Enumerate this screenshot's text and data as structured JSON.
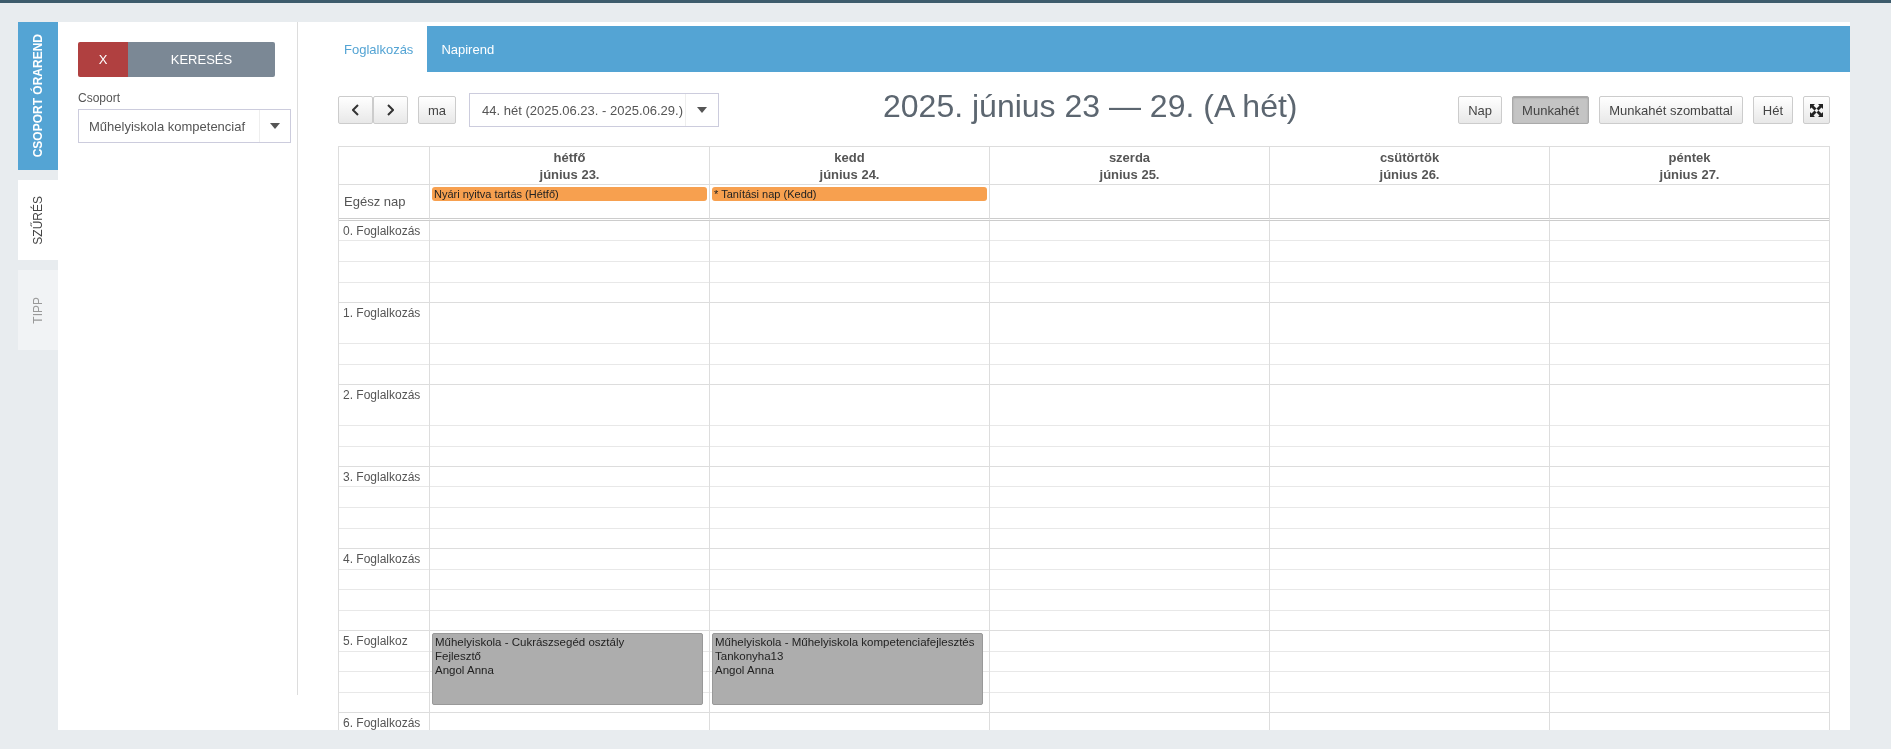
{
  "side_tabs": {
    "title": "CSOPORT ÓRAREND",
    "items": [
      {
        "label": "SZŰRÉS",
        "selected": true,
        "disabled": false
      },
      {
        "label": "TIPP",
        "selected": false,
        "disabled": true
      }
    ]
  },
  "filter": {
    "clear_button": "X",
    "search_button": "KERESÉS",
    "group_label": "Csoport",
    "group_value": "Műhelyiskola kompetenciaf"
  },
  "tabs": [
    {
      "label": "Foglalkozás",
      "selected": true
    },
    {
      "label": "Napirend",
      "selected": false
    }
  ],
  "toolbar": {
    "today_button": "ma",
    "week_select": "44. hét (2025.06.23. - 2025.06.29.)",
    "title": "2025. június 23 — 29. (A hét)",
    "view_buttons": [
      {
        "label": "Nap",
        "selected": false
      },
      {
        "label": "Munkahét",
        "selected": true
      },
      {
        "label": "Munkahét szombattal",
        "selected": false
      },
      {
        "label": "Hét",
        "selected": false
      }
    ]
  },
  "calendar": {
    "allday_label": "Egész nap",
    "days": [
      {
        "name": "hétfő",
        "date": "június 23.",
        "allday_event": "Nyári nyitva tartás (Hétfő)"
      },
      {
        "name": "kedd",
        "date": "június 24.",
        "allday_event": "* Tanítási nap (Kedd)"
      },
      {
        "name": "szerda",
        "date": "június 25."
      },
      {
        "name": "csütörtök",
        "date": "június 26."
      },
      {
        "name": "péntek",
        "date": "június 27."
      }
    ],
    "slots": [
      {
        "label": "0. Foglalkozás"
      },
      {
        "label": "1. Foglalkozás"
      },
      {
        "label": "2. Foglalkozás"
      },
      {
        "label": "3. Foglalkozás"
      },
      {
        "label": "4. Foglalkozás"
      },
      {
        "label": "5. Foglalkoz",
        "events": [
          {
            "lines": [
              "Műhelyiskola - Cukrászsegéd osztály",
              "Fejlesztő",
              "Angol Anna"
            ]
          },
          {
            "lines": [
              "Műhelyiskola - Műhelyiskola kompetenciafejlesztés",
              "Tankonyha13",
              "Angol Anna"
            ]
          }
        ]
      },
      {
        "label": "6. Foglalkozás"
      }
    ]
  }
}
